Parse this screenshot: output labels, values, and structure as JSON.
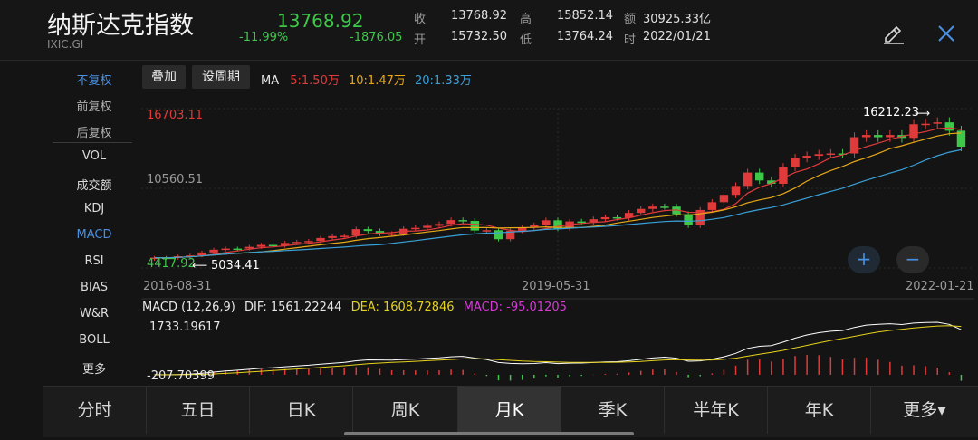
{
  "header": {
    "title": "纳斯达克指数",
    "code": "IXIC.GI",
    "price": "13768.92",
    "change_pct": "-11.99%",
    "change": "-1876.05",
    "stats": [
      {
        "label": "收",
        "value": "13768.92"
      },
      {
        "label": "开",
        "value": "15732.50"
      },
      {
        "label": "高",
        "value": "15852.14"
      },
      {
        "label": "低",
        "value": "13764.24"
      },
      {
        "label": "额",
        "value": "30925.33亿"
      },
      {
        "label": "时",
        "value": "2022/01/21"
      }
    ]
  },
  "side_menu": [
    "不复权",
    "前复权",
    "后复权",
    "VOL",
    "成交额",
    "KDJ",
    "MACD",
    "RSI",
    "BIAS",
    "W&R",
    "BOLL",
    "更多"
  ],
  "toolbar": {
    "overlay_label": "叠加",
    "period_label": "设周期",
    "ma_label": "MA",
    "ma5": "5:1.50万",
    "ma10": "10:1.47万",
    "ma20": "20:1.33万"
  },
  "chart": {
    "y_max_label": "16703.11",
    "y_mid_label": "10560.51",
    "y_min_label": "4417.92",
    "high_annotation": "16212.23",
    "low_annotation": "5034.41",
    "x_labels": [
      "2016-08-31",
      "2019-05-31",
      "2022-01-21"
    ],
    "macd_label": "MACD (12,26,9)",
    "dif": "DIF: 1561.22244",
    "dea": "DEA: 1608.72846",
    "macd": "MACD: -95.01205",
    "macd_max": "1733.19617",
    "macd_min": "-207.70399",
    "zoom_in": "+",
    "zoom_out": "−"
  },
  "colors": {
    "up": "#e03a3a",
    "down": "#3ec84a",
    "ma5": "#ffffff",
    "ma10": "#e6a817",
    "ma20": "#3aa0d8",
    "dea": "#e6d21c",
    "macd": "#d63ad6"
  },
  "tabs": [
    "分时",
    "五日",
    "日K",
    "周K",
    "月K",
    "季K",
    "半年K",
    "年K",
    "更多▾"
  ],
  "active_tab": "月K",
  "chart_data": {
    "type": "candlestick",
    "x_range": [
      "2016-08-31",
      "2022-01-21"
    ],
    "y_range": [
      4417.92,
      16703.11
    ],
    "closes": [
      5213,
      5189,
      5323,
      5383,
      5615,
      5825,
      5912,
      5911,
      6047,
      6198,
      6140,
      6348,
      6428,
      6496,
      6728,
      6874,
      6903,
      7411,
      7273,
      7063,
      7066,
      7442,
      7510,
      7672,
      7810,
      8110,
      8046,
      7306,
      7331,
      6635,
      7282,
      7533,
      7729,
      8095,
      7453,
      8006,
      7963,
      8175,
      8330,
      8292,
      8665,
      8973,
      9151,
      9150,
      8567,
      7700,
      8890,
      9490,
      10058,
      10745,
      11775,
      11168,
      10911,
      12199,
      12888,
      13070,
      13192,
      13247,
      13246,
      14504,
      14673,
      14503,
      14673,
      14448,
      15498,
      15538,
      15645,
      15000,
      13768.92
    ]
  }
}
